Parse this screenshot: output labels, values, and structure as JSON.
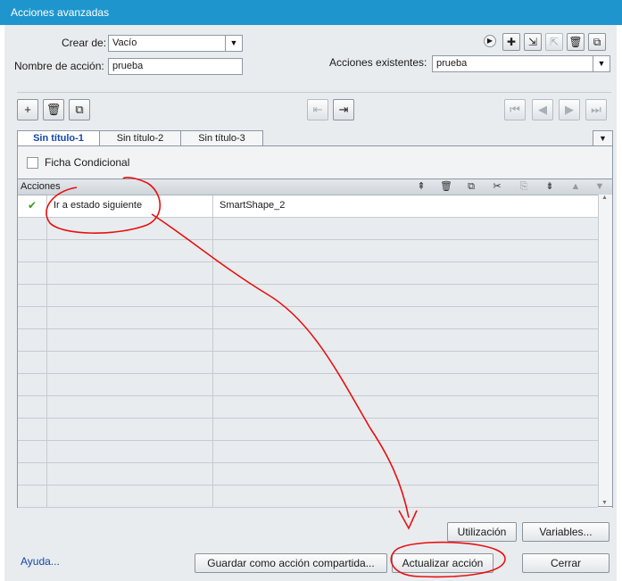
{
  "window": {
    "title": "Acciones avanzadas"
  },
  "form": {
    "crear_label": "Crear de:",
    "crear_value": "Vacío",
    "nombre_label": "Nombre de acción:",
    "nombre_value": "prueba",
    "existentes_label": "Acciones existentes:",
    "existentes_value": "prueba"
  },
  "tabs": [
    {
      "label": "Sin título-1",
      "active": true
    },
    {
      "label": "Sin título-2",
      "active": false
    },
    {
      "label": "Sin título-3",
      "active": false
    }
  ],
  "conditional": {
    "label": "Ficha Condicional",
    "checked": false
  },
  "grid": {
    "header": "Acciones",
    "rows": [
      {
        "status_icon": "check-icon",
        "action": "Ir a estado siguiente",
        "target": "SmartShape_2"
      },
      {
        "status_icon": "",
        "action": "",
        "target": ""
      },
      {
        "status_icon": "",
        "action": "",
        "target": ""
      },
      {
        "status_icon": "",
        "action": "",
        "target": ""
      },
      {
        "status_icon": "",
        "action": "",
        "target": ""
      },
      {
        "status_icon": "",
        "action": "",
        "target": ""
      },
      {
        "status_icon": "",
        "action": "",
        "target": ""
      },
      {
        "status_icon": "",
        "action": "",
        "target": ""
      },
      {
        "status_icon": "",
        "action": "",
        "target": ""
      },
      {
        "status_icon": "",
        "action": "",
        "target": ""
      },
      {
        "status_icon": "",
        "action": "",
        "target": ""
      },
      {
        "status_icon": "",
        "action": "",
        "target": ""
      },
      {
        "status_icon": "",
        "action": "",
        "target": ""
      },
      {
        "status_icon": "",
        "action": "",
        "target": ""
      }
    ]
  },
  "buttons": {
    "utilizacion": "Utilización",
    "variables": "Variables...",
    "ayuda": "Ayuda...",
    "guardar": "Guardar como acción compartida...",
    "actualizar": "Actualizar acción",
    "cerrar": "Cerrar"
  },
  "colors": {
    "titlebar": "#1e96cd",
    "active_tab_text": "#1447a8",
    "annotation": "#e81010",
    "check": "#3f9a1c"
  }
}
